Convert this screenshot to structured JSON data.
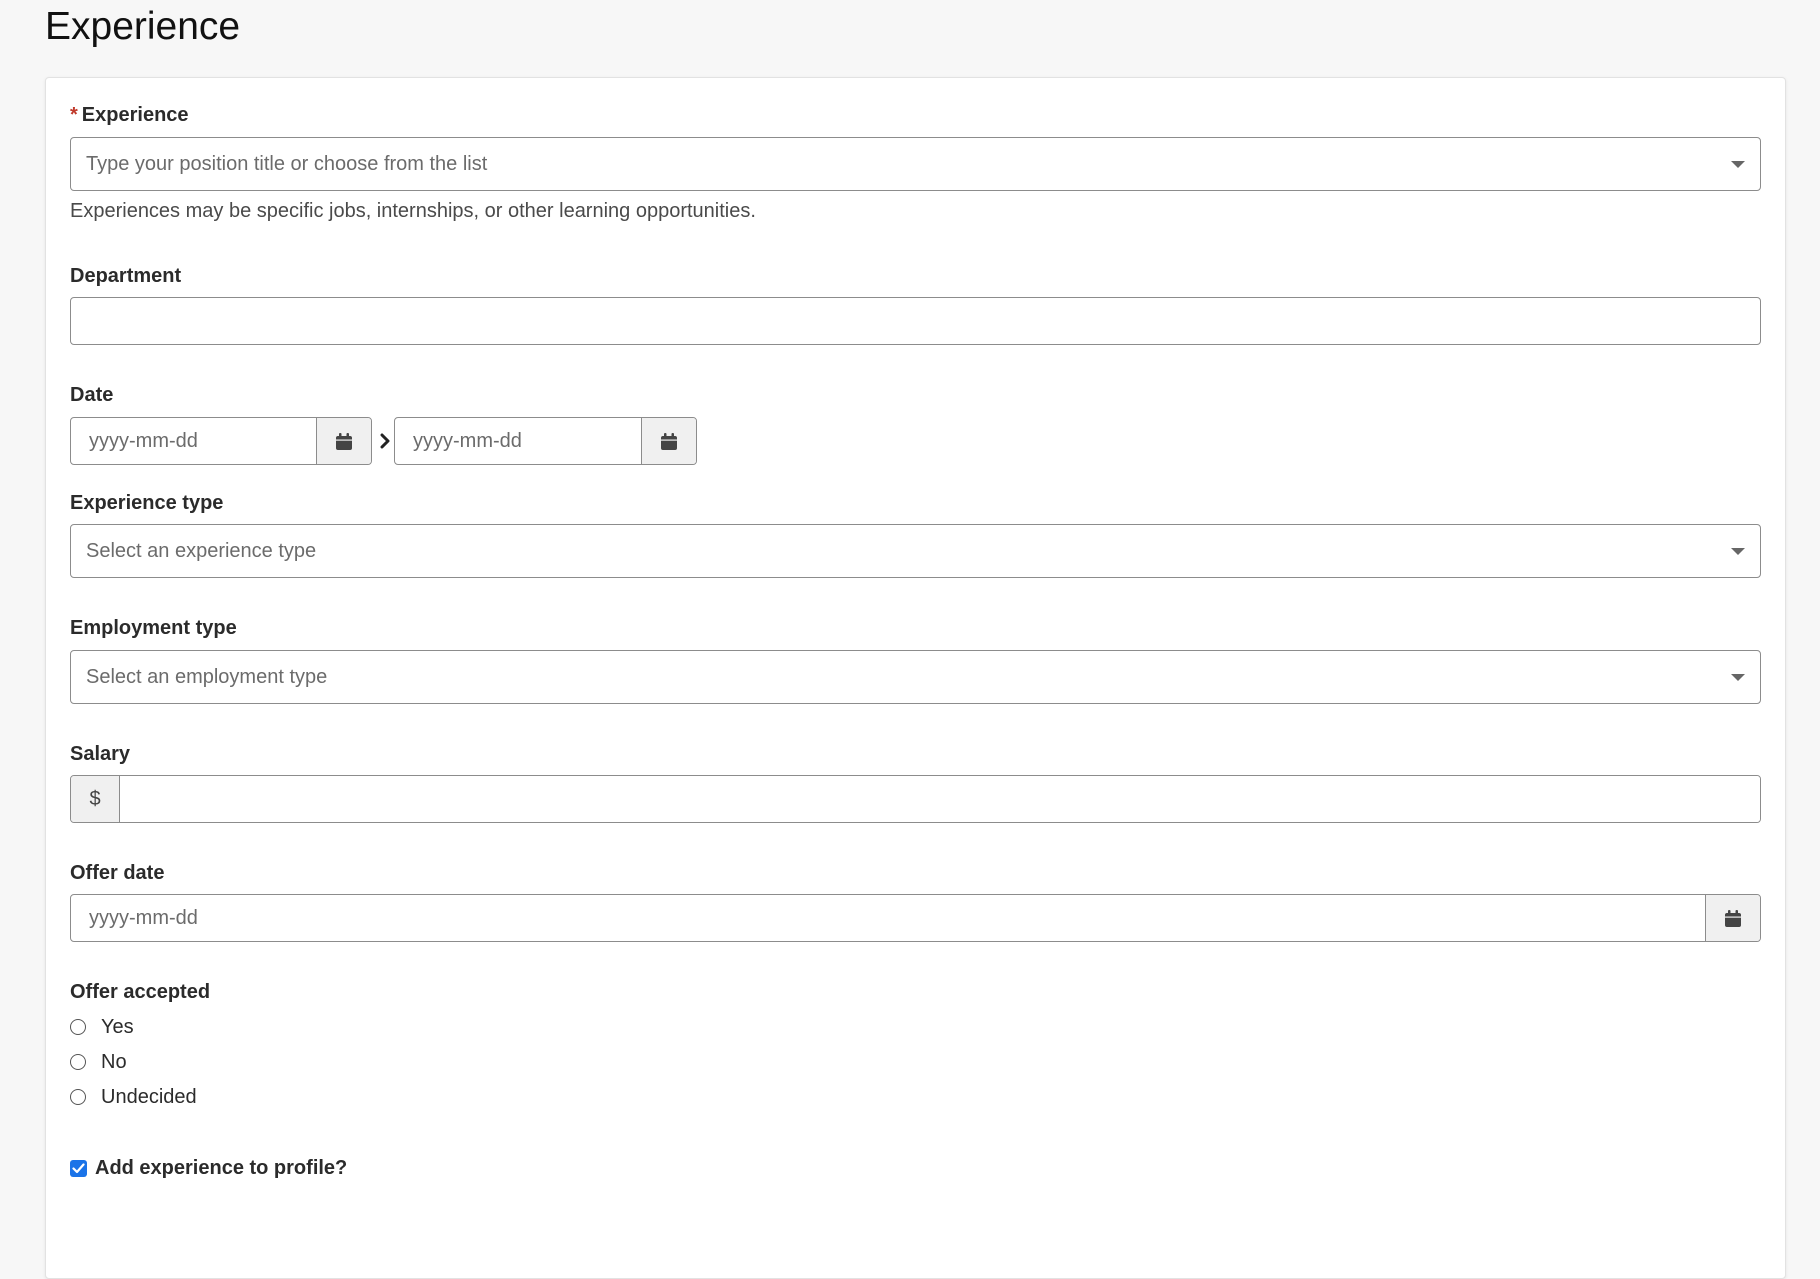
{
  "page": {
    "title": "Experience"
  },
  "form": {
    "experience": {
      "required_mark": "*",
      "label": "Experience",
      "placeholder": "Type your position title or choose from the list",
      "help": "Experiences may be specific jobs, internships, or other learning opportunities."
    },
    "department": {
      "label": "Department",
      "value": ""
    },
    "date": {
      "label": "Date",
      "start_placeholder": "yyyy-mm-dd",
      "end_placeholder": "yyyy-mm-dd"
    },
    "experience_type": {
      "label": "Experience type",
      "placeholder": "Select an experience type"
    },
    "employment_type": {
      "label": "Employment type",
      "placeholder": "Select an employment type"
    },
    "salary": {
      "label": "Salary",
      "prefix": "$",
      "value": ""
    },
    "offer_date": {
      "label": "Offer date",
      "placeholder": "yyyy-mm-dd"
    },
    "offer_accepted": {
      "label": "Offer accepted",
      "options": [
        {
          "label": "Yes",
          "selected": false
        },
        {
          "label": "No",
          "selected": false
        },
        {
          "label": "Undecided",
          "selected": false
        }
      ]
    },
    "add_to_profile": {
      "label": "Add experience to profile?",
      "checked": true
    }
  },
  "colors": {
    "required": "#c0392b",
    "checkbox_accent": "#1a73e8",
    "border": "#8c8c8c"
  },
  "icons": [
    "calendar-icon",
    "chevron-right-icon",
    "caret-down-icon",
    "check-icon"
  ]
}
